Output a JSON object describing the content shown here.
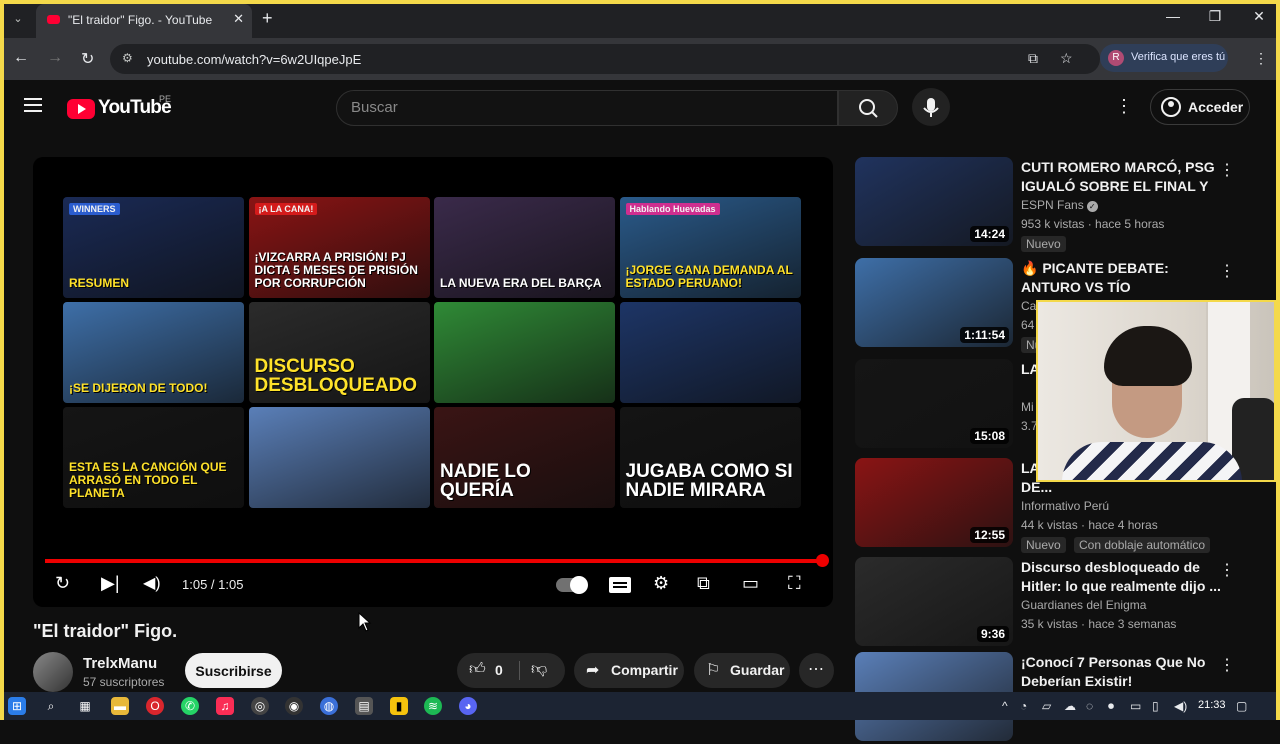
{
  "browser": {
    "tab_title": "\"El traidor\" Figo. - YouTube",
    "url": "youtube.com/watch?v=6w2UIqpeJpE",
    "verify_label": "Verifica que eres tú",
    "verify_avatar": "R"
  },
  "header": {
    "logo_text": "YouTube",
    "country_code": "PE",
    "search_placeholder": "Buscar",
    "signin_label": "Acceder"
  },
  "player": {
    "time": "1:05 / 1:05",
    "progress": 1.0,
    "endscreen": [
      {
        "text": "Resumen",
        "color": "#1a2a55",
        "style": "yellow",
        "badge": "WINNERS",
        "badge_color": "#2b5dcf"
      },
      {
        "text": "¡Vizcarra a prisión! PJ dicta 5 meses de prisión por corrupción",
        "color": "#8a1414",
        "style": "",
        "badge": "¡A LA CANA!",
        "badge_color": "#d41b1b"
      },
      {
        "text": "La nueva era del Barça",
        "color": "#3a2a4a",
        "style": "",
        "badge": "",
        "badge_color": ""
      },
      {
        "text": "¡Jorge gana demanda al estado peruano!",
        "color": "#2a5a8a",
        "style": "yellow",
        "badge": "Hablando Huevadas",
        "badge_color": "#cf2e8f"
      },
      {
        "text": "¡Se dijeron de todo!",
        "color": "#3e6fa8",
        "style": "yellow",
        "badge": "",
        "badge_color": ""
      },
      {
        "text": "Discurso desbloqueado",
        "color": "#2b2b2b",
        "style": "yellow big",
        "badge": "",
        "badge_color": ""
      },
      {
        "text": "",
        "color": "#2f8a36",
        "style": "",
        "badge": "",
        "badge_color": ""
      },
      {
        "text": "",
        "color": "#1d3566",
        "style": "",
        "badge": "",
        "badge_color": ""
      },
      {
        "text": "Esta es la canción que arrasó en todo el planeta",
        "color": "#151515",
        "style": "yellow",
        "badge": "",
        "badge_color": ""
      },
      {
        "text": "",
        "color": "#5a7fb8",
        "style": "",
        "badge": "",
        "badge_color": ""
      },
      {
        "text": "Nadie lo quería",
        "color": "#3a1414",
        "style": "big",
        "badge": "",
        "badge_color": ""
      },
      {
        "text": "Jugaba como si nadie mirara",
        "color": "#141414",
        "style": "big",
        "badge": "",
        "badge_color": ""
      }
    ]
  },
  "video": {
    "title": "\"El traidor\" Figo.",
    "channel": "TrelxManu",
    "subscribers": "57 suscriptores",
    "subscribe_label": "Suscribirse",
    "likes": "0",
    "share_label": "Compartir",
    "save_label": "Guardar"
  },
  "recommended": [
    {
      "title": "CUTI ROMERO MARCÓ, PSG IGUALÓ SOBRE EL FINAL Y SE...",
      "channel": "ESPN Fans",
      "verified": true,
      "meta": "953 k vistas · hace 5 horas",
      "duration": "14:24",
      "badges": [
        "Nuevo"
      ],
      "color": "#20335e"
    },
    {
      "title": "🔥 PICANTE DEBATE: ANTURO VS TÍO ROCKEFELLER",
      "channel": "Ca",
      "verified": false,
      "meta": "64",
      "duration": "1:11:54",
      "badges": [
        "Nu"
      ],
      "color": "#3e6fa8"
    },
    {
      "title": "LA",
      "channel": "Mi",
      "verified": false,
      "meta": "3.7",
      "duration": "15:08",
      "badges": [],
      "color": "#151515"
    },
    {
      "title": "LA PRISIÓN DICTAN 5 MESES DE...",
      "channel": "Informativo Perú",
      "verified": false,
      "meta": "44 k vistas · hace 4 horas",
      "duration": "12:55",
      "badges": [
        "Nuevo",
        "Con doblaje automático"
      ],
      "color": "#8a1414"
    },
    {
      "title": "Discurso desbloqueado de Hitler: lo que realmente dijo ...",
      "channel": "Guardianes del Enigma",
      "verified": false,
      "meta": "35 k vistas · hace 3 semanas",
      "duration": "9:36",
      "badges": [],
      "color": "#2b2b2b"
    },
    {
      "title": "¡Conocí 7 Personas Que No Deberían Existir!",
      "channel": "",
      "verified": false,
      "meta": "",
      "duration": "",
      "badges": [],
      "color": "#5a7fb8"
    }
  ],
  "taskbar": {
    "clock": "21:33"
  }
}
